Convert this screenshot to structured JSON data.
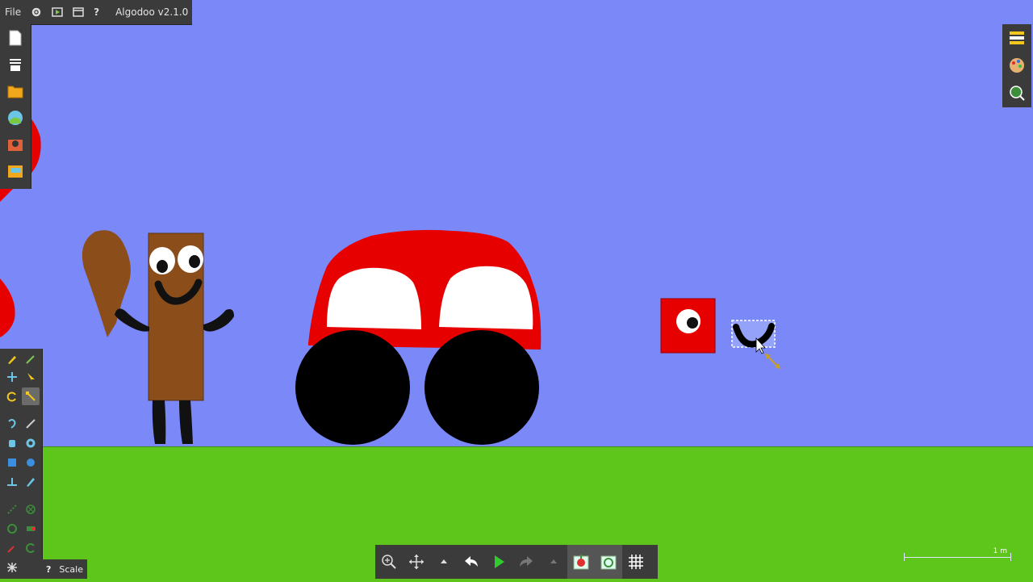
{
  "app": {
    "title": "Algodoo v2.1.0"
  },
  "menubar": {
    "file_label": "File"
  },
  "scale_button": {
    "label": "Scale"
  },
  "scale_indicator": {
    "label": "1 m"
  },
  "colors": {
    "sky": "#7a88f8",
    "ground": "#5ec61a",
    "toolbar_bg": "#3b3b3b",
    "red": "#e60000",
    "brown": "#8b4e1a",
    "black": "#000000"
  },
  "left_toolbar": {
    "icons": [
      "new-scene-icon",
      "layers-icon",
      "open-folder-icon",
      "scene-browser-icon",
      "algobox-icon",
      "save-icon"
    ]
  },
  "right_toolbar": {
    "icons": [
      "properties-icon",
      "appearance-icon",
      "search-icon"
    ]
  },
  "bottom_toolbar": {
    "icons": [
      "zoom-icon",
      "pan-icon",
      "history-dropdown-icon",
      "undo-icon",
      "play-icon",
      "redo-icon",
      "redo-dropdown-icon",
      "gravity-toggle-icon",
      "air-friction-icon",
      "grid-icon"
    ]
  },
  "tools": [
    "sketch",
    "brush",
    "move",
    "drag",
    "rotate",
    "scale",
    "rope",
    "cut",
    "spring",
    "gear",
    "box",
    "circle",
    "plane",
    "pen",
    "fixate",
    "hinge",
    "tracer",
    "thruster",
    "laser",
    "chain",
    "eraser",
    "knife"
  ]
}
